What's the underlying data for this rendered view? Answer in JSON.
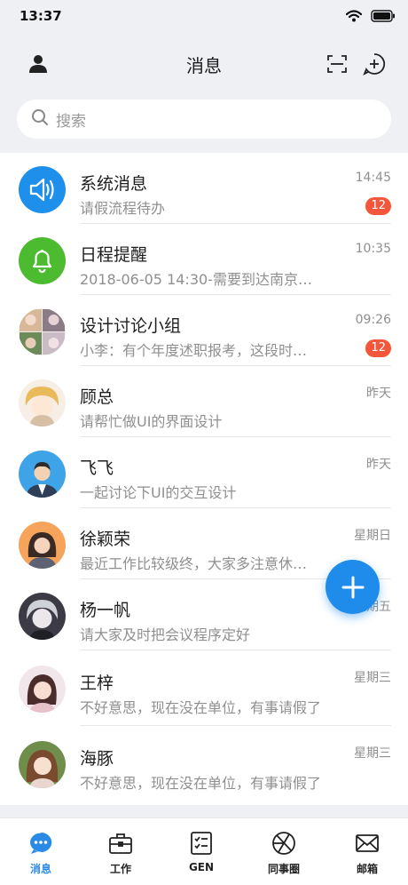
{
  "status_bar": {
    "time": "13:37"
  },
  "header": {
    "title": "消息"
  },
  "search": {
    "placeholder": "搜索"
  },
  "conversations": [
    {
      "name": "系统消息",
      "preview": "请假流程待办",
      "time": "14:45",
      "badge": "12"
    },
    {
      "name": "日程提醒",
      "preview": "2018-06-05 14:30-需要到达南京…",
      "time": "10:35",
      "badge": ""
    },
    {
      "name": "设计讨论小组",
      "preview": "小李：有个年度述职报考，这段时…",
      "time": "09:26",
      "badge": "12"
    },
    {
      "name": "顾总",
      "preview": "请帮忙做UI的界面设计",
      "time": "昨天",
      "badge": ""
    },
    {
      "name": "飞飞",
      "preview": "一起讨论下UI的交互设计",
      "time": "昨天",
      "badge": ""
    },
    {
      "name": "徐颖荣",
      "preview": "最近工作比较级终，大家多注意休…",
      "time": "星期日",
      "badge": ""
    },
    {
      "name": "杨一帆",
      "preview": "请大家及时把会议程序定好",
      "time": "星期五",
      "badge": ""
    },
    {
      "name": "王梓",
      "preview": "不好意思，现在没在单位，有事请假了",
      "time": "星期三",
      "badge": ""
    },
    {
      "name": "海豚",
      "preview": "不好意思，现在没在单位，有事请假了",
      "time": "星期三",
      "badge": ""
    }
  ],
  "tabs": [
    {
      "label": "消息",
      "icon": "chat-bubble-icon",
      "active": true
    },
    {
      "label": "工作",
      "icon": "briefcase-icon",
      "active": false
    },
    {
      "label": "GEN",
      "icon": "checklist-icon",
      "active": false
    },
    {
      "label": "同事圈",
      "icon": "aperture-icon",
      "active": false
    },
    {
      "label": "邮箱",
      "icon": "mail-icon",
      "active": false
    }
  ],
  "colors": {
    "accent": "#2a8ae6",
    "badge": "#f3563a",
    "system_avatar": "#1e8fea",
    "reminder_avatar": "#4cbb2f",
    "fab": "#1f8ceb"
  }
}
